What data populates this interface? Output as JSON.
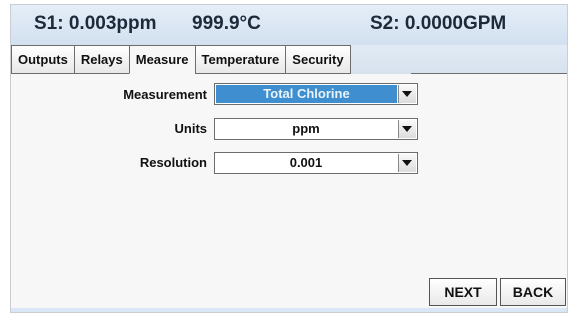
{
  "header": {
    "sensor1": "S1: 0.003ppm",
    "temperature": "999.9°C",
    "sensor2": "S2: 0.0000GPM"
  },
  "tabs": [
    {
      "label": "Outputs",
      "active": false
    },
    {
      "label": "Relays",
      "active": false
    },
    {
      "label": "Measure",
      "active": true
    },
    {
      "label": "Temperature",
      "active": false
    },
    {
      "label": "Security",
      "active": false
    }
  ],
  "form": {
    "measurement": {
      "label": "Measurement",
      "value": "Total Chlorine"
    },
    "units": {
      "label": "Units",
      "value": "ppm"
    },
    "resolution": {
      "label": "Resolution",
      "value": "0.001"
    }
  },
  "buttons": {
    "next": "NEXT",
    "back": "BACK"
  },
  "colors": {
    "selected_field": "#3f8fd0",
    "header_bg": "#dde8f4"
  }
}
